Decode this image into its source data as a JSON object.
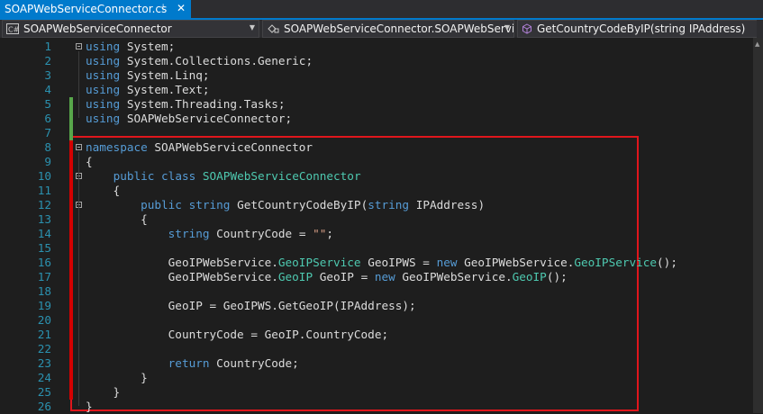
{
  "tab": {
    "title": "SOAPWebServiceConnector.cs",
    "pin_glyph": "⊹",
    "close_glyph": "✕"
  },
  "navbar": {
    "project": "SOAPWebServiceConnector",
    "type": "SOAPWebServiceConnector.SOAPWebServiceC",
    "member": "GetCountryCodeByIP(string IPAddress)"
  },
  "colors": {
    "accent": "#007acc",
    "keyword": "#569cd6",
    "type": "#4ec9b0",
    "string": "#d69d85",
    "line_number": "#2b91af",
    "highlight_box": "#e0161c"
  },
  "lines": [
    {
      "n": "1",
      "tokens": [
        {
          "c": "kw",
          "t": "using"
        },
        {
          "c": "pl",
          "t": " System;"
        }
      ]
    },
    {
      "n": "2",
      "tokens": [
        {
          "c": "kw",
          "t": "using"
        },
        {
          "c": "pl",
          "t": " System.Collections.Generic;"
        }
      ]
    },
    {
      "n": "3",
      "tokens": [
        {
          "c": "kw",
          "t": "using"
        },
        {
          "c": "pl",
          "t": " System.Linq;"
        }
      ]
    },
    {
      "n": "4",
      "tokens": [
        {
          "c": "kw",
          "t": "using"
        },
        {
          "c": "pl",
          "t": " System.Text;"
        }
      ]
    },
    {
      "n": "5",
      "tokens": [
        {
          "c": "kw",
          "t": "using"
        },
        {
          "c": "pl",
          "t": " System.Threading.Tasks;"
        }
      ]
    },
    {
      "n": "6",
      "tokens": [
        {
          "c": "kw",
          "t": "using"
        },
        {
          "c": "pl",
          "t": " SOAPWebServiceConnector;"
        }
      ]
    },
    {
      "n": "7",
      "tokens": []
    },
    {
      "n": "8",
      "tokens": [
        {
          "c": "kw",
          "t": "namespace"
        },
        {
          "c": "pl",
          "t": " SOAPWebServiceConnector"
        }
      ]
    },
    {
      "n": "9",
      "tokens": [
        {
          "c": "pl",
          "t": "{"
        }
      ]
    },
    {
      "n": "10",
      "tokens": [
        {
          "c": "pl",
          "t": "    "
        },
        {
          "c": "kw",
          "t": "public"
        },
        {
          "c": "pl",
          "t": " "
        },
        {
          "c": "kw",
          "t": "class"
        },
        {
          "c": "pl",
          "t": " "
        },
        {
          "c": "ty",
          "t": "SOAPWebServiceConnector"
        }
      ]
    },
    {
      "n": "11",
      "tokens": [
        {
          "c": "pl",
          "t": "    {"
        }
      ]
    },
    {
      "n": "12",
      "tokens": [
        {
          "c": "pl",
          "t": "        "
        },
        {
          "c": "kw",
          "t": "public"
        },
        {
          "c": "pl",
          "t": " "
        },
        {
          "c": "kw",
          "t": "string"
        },
        {
          "c": "pl",
          "t": " GetCountryCodeByIP("
        },
        {
          "c": "kw",
          "t": "string"
        },
        {
          "c": "pl",
          "t": " IPAddress)"
        }
      ]
    },
    {
      "n": "13",
      "tokens": [
        {
          "c": "pl",
          "t": "        {"
        }
      ]
    },
    {
      "n": "14",
      "tokens": [
        {
          "c": "pl",
          "t": "            "
        },
        {
          "c": "kw",
          "t": "string"
        },
        {
          "c": "pl",
          "t": " CountryCode = "
        },
        {
          "c": "st",
          "t": "\"\""
        },
        {
          "c": "pl",
          "t": ";"
        }
      ]
    },
    {
      "n": "15",
      "tokens": []
    },
    {
      "n": "16",
      "tokens": [
        {
          "c": "pl",
          "t": "            GeoIPWebService."
        },
        {
          "c": "ty",
          "t": "GeoIPService"
        },
        {
          "c": "pl",
          "t": " GeoIPWS = "
        },
        {
          "c": "kw",
          "t": "new"
        },
        {
          "c": "pl",
          "t": " GeoIPWebService."
        },
        {
          "c": "ty",
          "t": "GeoIPService"
        },
        {
          "c": "pl",
          "t": "();"
        }
      ]
    },
    {
      "n": "17",
      "tokens": [
        {
          "c": "pl",
          "t": "            GeoIPWebService."
        },
        {
          "c": "ty",
          "t": "GeoIP"
        },
        {
          "c": "pl",
          "t": " GeoIP = "
        },
        {
          "c": "kw",
          "t": "new"
        },
        {
          "c": "pl",
          "t": " GeoIPWebService."
        },
        {
          "c": "ty",
          "t": "GeoIP"
        },
        {
          "c": "pl",
          "t": "();"
        }
      ]
    },
    {
      "n": "18",
      "tokens": []
    },
    {
      "n": "19",
      "tokens": [
        {
          "c": "pl",
          "t": "            GeoIP = GeoIPWS.GetGeoIP(IPAddress);"
        }
      ]
    },
    {
      "n": "20",
      "tokens": []
    },
    {
      "n": "21",
      "tokens": [
        {
          "c": "pl",
          "t": "            CountryCode = GeoIP.CountryCode;"
        }
      ]
    },
    {
      "n": "22",
      "tokens": []
    },
    {
      "n": "23",
      "tokens": [
        {
          "c": "pl",
          "t": "            "
        },
        {
          "c": "kw",
          "t": "return"
        },
        {
          "c": "pl",
          "t": " CountryCode;"
        }
      ]
    },
    {
      "n": "24",
      "tokens": [
        {
          "c": "pl",
          "t": "        }"
        }
      ]
    },
    {
      "n": "25",
      "tokens": [
        {
          "c": "pl",
          "t": "    }"
        }
      ]
    },
    {
      "n": "26",
      "tokens": [
        {
          "c": "pl",
          "t": "}"
        }
      ]
    }
  ]
}
